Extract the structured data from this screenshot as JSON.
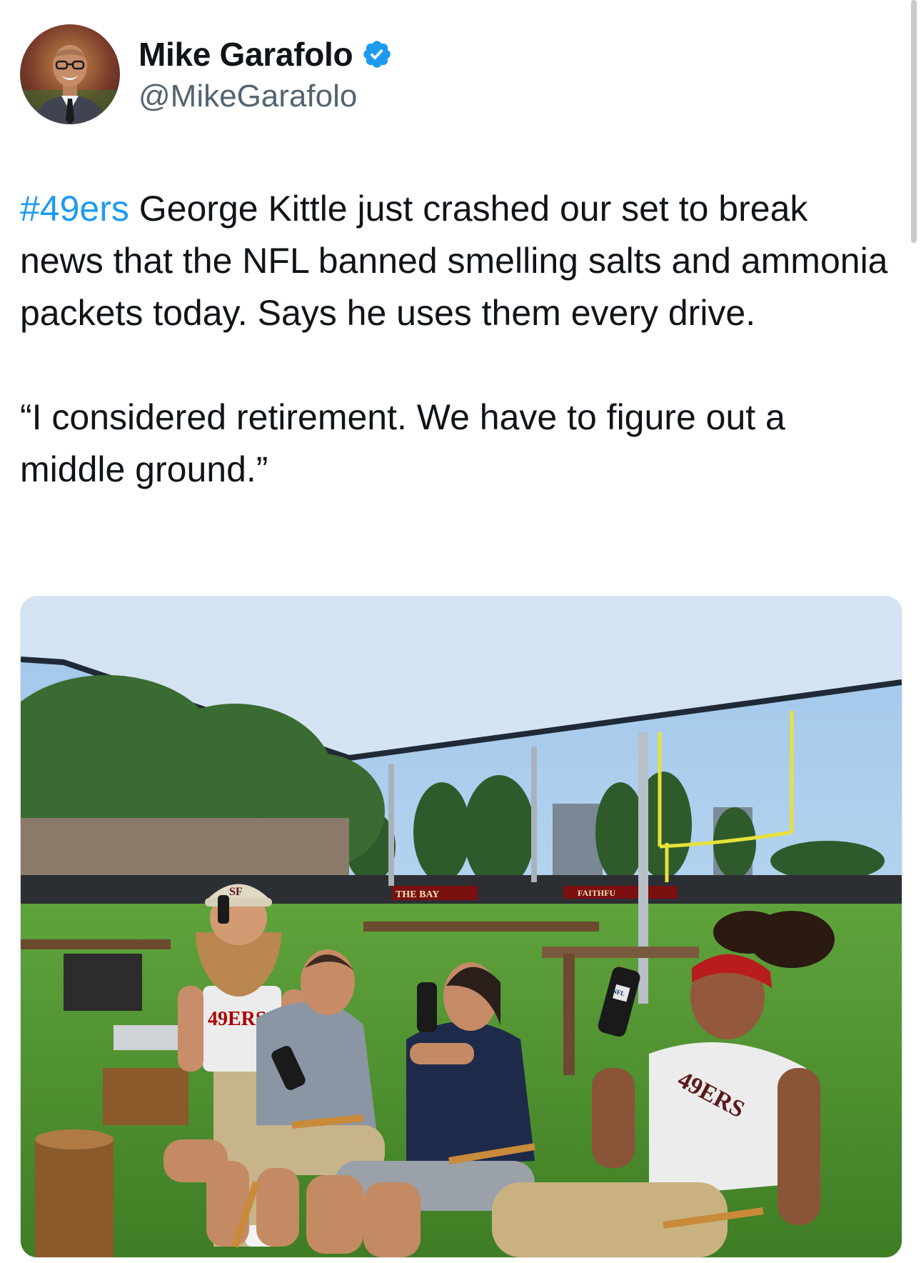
{
  "user": {
    "display_name": "Mike Garafolo",
    "handle": "@MikeGarafolo",
    "verified": true,
    "avatar_icon": "profile-photo",
    "verified_icon": "verified-badge-icon"
  },
  "tweet": {
    "hashtag": "#49ers",
    "paragraph1_rest": " George Kittle just crashed our set to break news that the NFL banned smelling salts and ammonia packets today. Says he uses them every drive.",
    "paragraph2": "“I considered retirement. We have to figure out a middle ground.”"
  },
  "media": {
    "banner_text": "THE BAY",
    "faithful_text": "FAITHFU",
    "shirt_text": "49ERS",
    "tank_text": "49ERS",
    "cap_text": "SF",
    "mic_flag_text": "NFL"
  },
  "colors": {
    "hashtag": "#1d9bf0",
    "handle": "#536471",
    "verified": "#1d9bf0",
    "niners_red": "#aa0000",
    "niners_gold": "#b3995d"
  }
}
